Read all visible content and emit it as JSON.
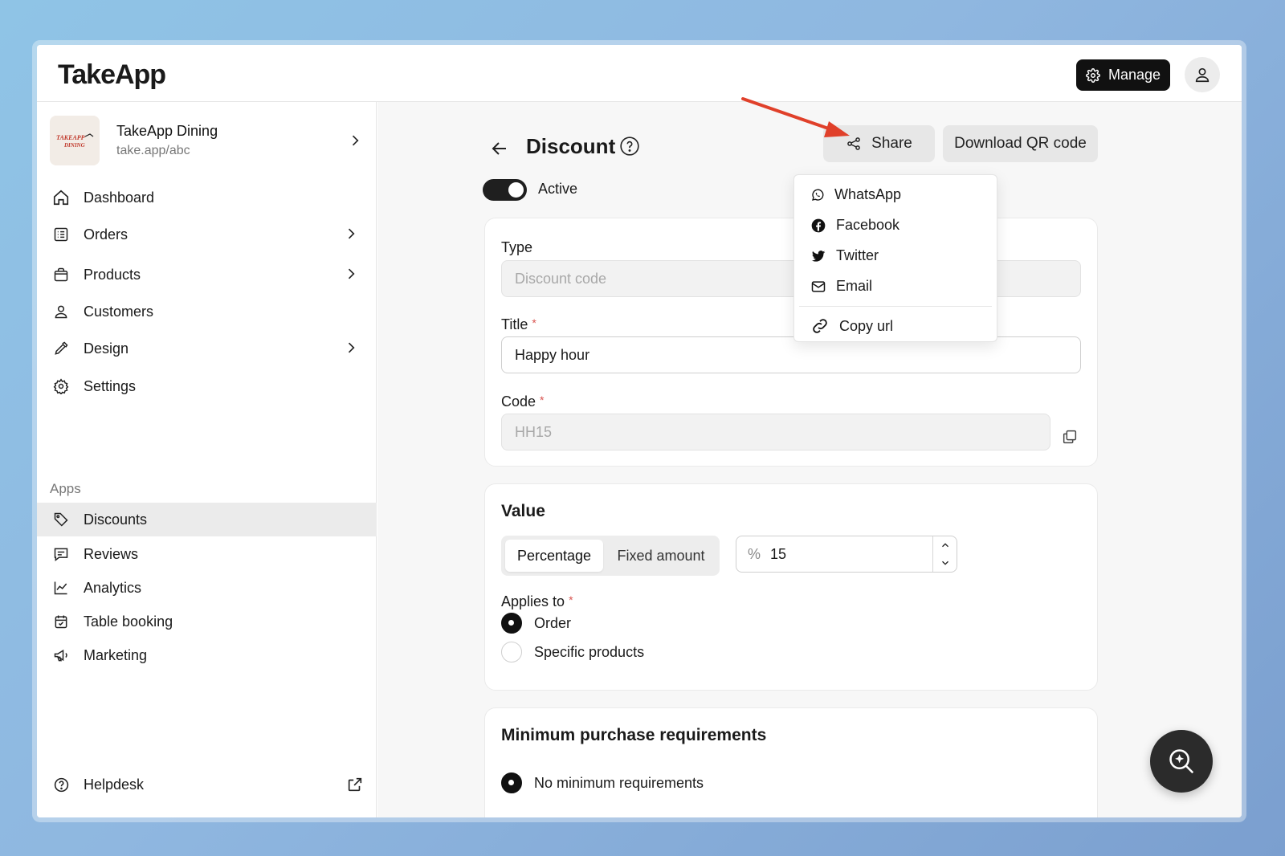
{
  "app": {
    "logo": "TakeApp"
  },
  "header": {
    "manage_label": "Manage"
  },
  "store": {
    "name": "TakeApp Dining",
    "url": "take.app/abc",
    "thumb_text": "TAKEAPP DINING"
  },
  "sidebar": {
    "items": [
      {
        "label": "Dashboard"
      },
      {
        "label": "Orders"
      },
      {
        "label": "Products"
      },
      {
        "label": "Customers"
      },
      {
        "label": "Design"
      },
      {
        "label": "Settings"
      }
    ],
    "apps_label": "Apps",
    "apps": [
      {
        "label": "Discounts"
      },
      {
        "label": "Reviews"
      },
      {
        "label": "Analytics"
      },
      {
        "label": "Table booking"
      },
      {
        "label": "Marketing"
      }
    ],
    "helpdesk_label": "Helpdesk"
  },
  "page": {
    "title": "Discount",
    "share_label": "Share",
    "qr_label": "Download QR code",
    "active_label": "Active"
  },
  "share_menu": {
    "items": [
      {
        "label": "WhatsApp"
      },
      {
        "label": "Facebook"
      },
      {
        "label": "Twitter"
      },
      {
        "label": "Email"
      },
      {
        "label": "Copy url"
      }
    ]
  },
  "form": {
    "type_label": "Type",
    "type_value": "Discount code",
    "title_label": "Title",
    "title_value": "Happy hour",
    "code_label": "Code",
    "code_value": "HH15",
    "required_mark": "*"
  },
  "value_section": {
    "title": "Value",
    "options": [
      "Percentage",
      "Fixed amount"
    ],
    "selected": "Percentage",
    "prefix": "%",
    "amount": "15",
    "applies_label": "Applies to",
    "applies_options": [
      "Order",
      "Specific products"
    ],
    "applies_selected": "Order"
  },
  "min_section": {
    "title": "Minimum purchase requirements",
    "option": "No minimum requirements"
  },
  "colors": {
    "accent": "#111111",
    "annotation_arrow": "#e0402a"
  }
}
